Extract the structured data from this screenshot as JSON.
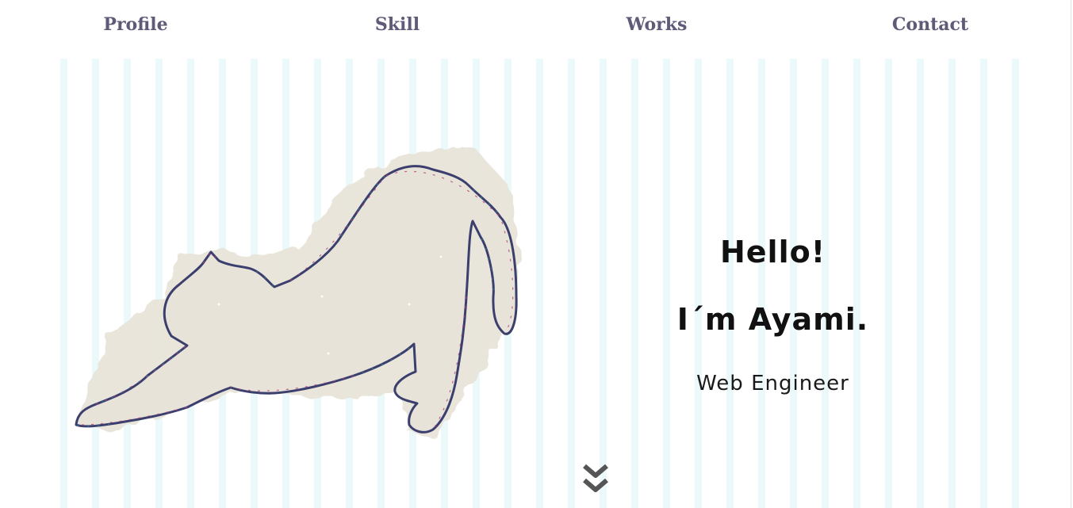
{
  "nav": {
    "items": [
      {
        "label": "Profile"
      },
      {
        "label": "Skill"
      },
      {
        "label": "Works"
      },
      {
        "label": "Contact"
      }
    ]
  },
  "hero": {
    "greeting": "Hello!",
    "name": "I´m Ayami.",
    "role": "Web Engineer"
  },
  "colors": {
    "nav_text": "#5e5a78",
    "stripe": "#ebf9fb",
    "cat_fill": "#e8e3d8",
    "cat_outline": "#3b3f6e",
    "arrow": "#555555"
  },
  "icons": {
    "hero_image": "stretching-cat-icon",
    "scroll": "double-chevron-down-icon"
  }
}
